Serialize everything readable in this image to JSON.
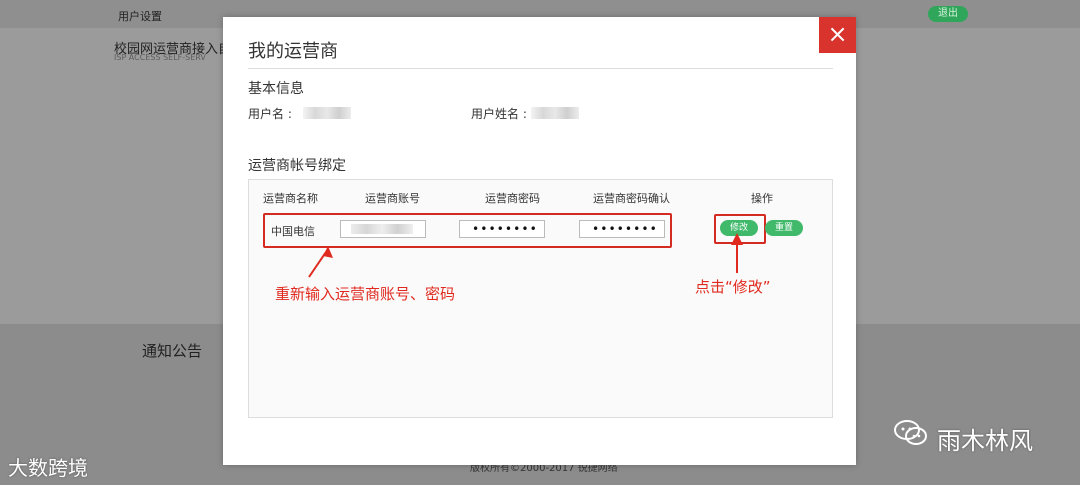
{
  "background": {
    "nav": "用户设置",
    "logout": "退出",
    "title": "校园网运营商接入自",
    "subtitle": "ISP ACCESS SELF-SERV",
    "notice": "通知公告",
    "footer": "版权所有©2000-2017 锐捷网络"
  },
  "modal": {
    "title": "我的运营商",
    "basic_info": "基本信息",
    "username_label": "用户名 :",
    "fullname_label": "用户姓名 :",
    "binding_title": "运营商帐号绑定",
    "headers": [
      "运营商名称",
      "运营商账号",
      "运营商密码",
      "运营商密码确认",
      "操作"
    ],
    "row": {
      "carrier": "中国电信",
      "password": "••••••••",
      "password_confirm": "••••••••"
    },
    "buttons": {
      "edit": "修改",
      "reset": "重置"
    },
    "close": "×"
  },
  "annotations": {
    "reenter": "重新输入运营商账号、密码",
    "click_edit": "点击“修改”"
  },
  "watermarks": {
    "left": "大数跨境",
    "right": "雨木林风"
  },
  "colors": {
    "accent_green": "#41b96b",
    "close_red": "#d9332e",
    "annotation_red": "#e02a1f"
  }
}
